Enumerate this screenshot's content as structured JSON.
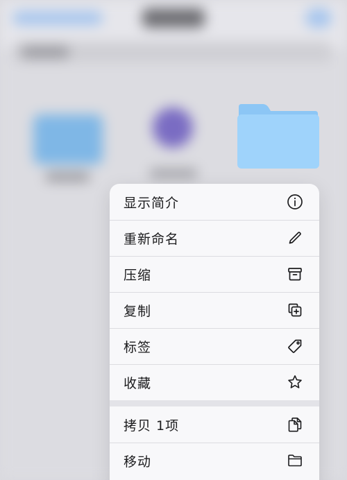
{
  "menu": {
    "items": [
      {
        "label": "显示简介",
        "icon": "info-icon"
      },
      {
        "label": "重新命名",
        "icon": "pencil-icon"
      },
      {
        "label": "压缩",
        "icon": "archive-box-icon"
      },
      {
        "label": "复制",
        "icon": "duplicate-plus-icon"
      },
      {
        "label": "标签",
        "icon": "tag-icon"
      },
      {
        "label": "收藏",
        "icon": "star-icon"
      },
      {
        "label": "拷贝 1项",
        "icon": "copy-docs-icon"
      },
      {
        "label": "移动",
        "icon": "folder-icon"
      }
    ]
  },
  "colors": {
    "folder_light": "#9fd3fb",
    "folder_tab": "#8cc6f5",
    "menu_background": "#f8f8fa",
    "text": "#1c1c1e"
  }
}
